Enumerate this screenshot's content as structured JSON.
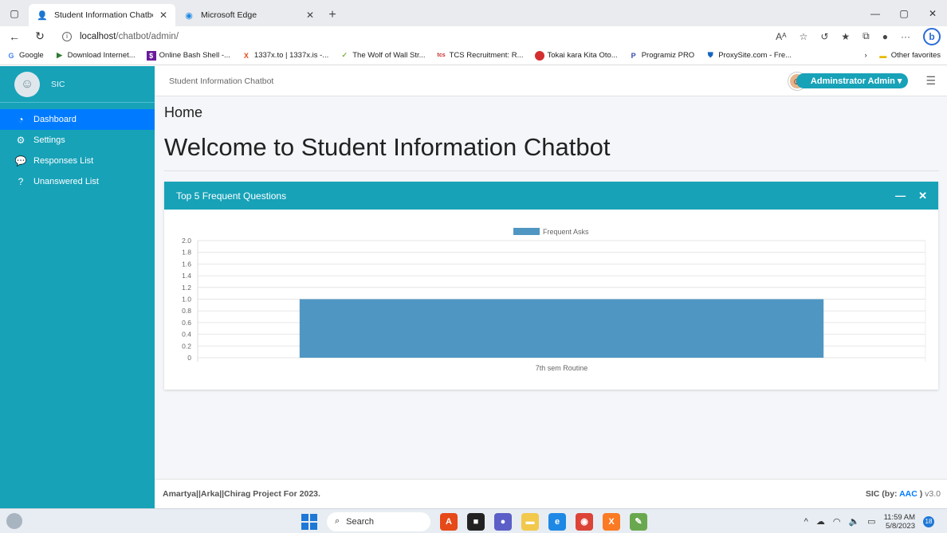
{
  "browser": {
    "tabs": [
      {
        "label": "Student Information Chatbot",
        "active": true,
        "favicon": "person-icon"
      },
      {
        "label": "Microsoft Edge",
        "active": false,
        "favicon": "edge-icon"
      }
    ],
    "url_host": "localhost",
    "url_path": "/chatbot/admin/",
    "favorites": [
      {
        "label": "Google",
        "icon": "google-icon",
        "color": "#4285f4"
      },
      {
        "label": "Download Internet...",
        "icon": "play-icon",
        "color": "#2e7d32"
      },
      {
        "label": "Online Bash Shell -...",
        "icon": "bash-icon",
        "color": "#6a1b9a"
      },
      {
        "label": "1337x.to | 1337x.is -...",
        "icon": "x-icon",
        "color": "#e64a19"
      },
      {
        "label": "The Wolf of Wall Str...",
        "icon": "yts-icon",
        "color": "#7cb342"
      },
      {
        "label": "TCS Recruitment: R...",
        "icon": "tcs-icon",
        "color": "#c62828"
      },
      {
        "label": "Tokai kara Kita Oto...",
        "icon": "red-circle-icon",
        "color": "#d32f2f"
      },
      {
        "label": "Programiz PRO",
        "icon": "programiz-icon",
        "color": "#3949ab"
      },
      {
        "label": "ProxySite.com - Fre...",
        "icon": "shield-icon",
        "color": "#1565c0"
      }
    ],
    "other_favorites": "Other favorites"
  },
  "sidebar": {
    "brand": "SIC",
    "items": [
      {
        "label": "Dashboard",
        "icon": "dashboard-icon",
        "active": true
      },
      {
        "label": "Settings",
        "icon": "cogs-icon",
        "active": false
      },
      {
        "label": "Responses List",
        "icon": "comment-icon",
        "active": false
      },
      {
        "label": "Unanswered List",
        "icon": "question-icon",
        "active": false
      }
    ]
  },
  "topnav": {
    "title": "Student Information Chatbot",
    "user": "Adminstrator Admin"
  },
  "content": {
    "breadcrumb": "Home",
    "welcome": "Welcome to Student Information Chatbot",
    "card_title": "Top 5 Frequent Questions"
  },
  "chart_data": {
    "type": "bar",
    "categories": [
      "7th sem Routine"
    ],
    "series": [
      {
        "name": "Frequent Asks",
        "values": [
          1
        ],
        "color": "#5096c3"
      }
    ],
    "ylim": [
      0,
      2.0
    ],
    "yticks": [
      "2.0",
      "1.8",
      "1.6",
      "1.4",
      "1.2",
      "1.0",
      "0.8",
      "0.6",
      "0.4",
      "0.2",
      "0"
    ],
    "legend": "top",
    "grid": true
  },
  "footer": {
    "left": "Amartya||Arka||Chirag Project For 2023.",
    "right_prefix": "SIC (by: ",
    "right_brand": "AAC",
    "right_suffix": " )",
    "version": " v3.0"
  },
  "taskbar": {
    "search": "Search",
    "time": "11:59 AM",
    "date": "5/8/2023",
    "notifications": "18"
  }
}
